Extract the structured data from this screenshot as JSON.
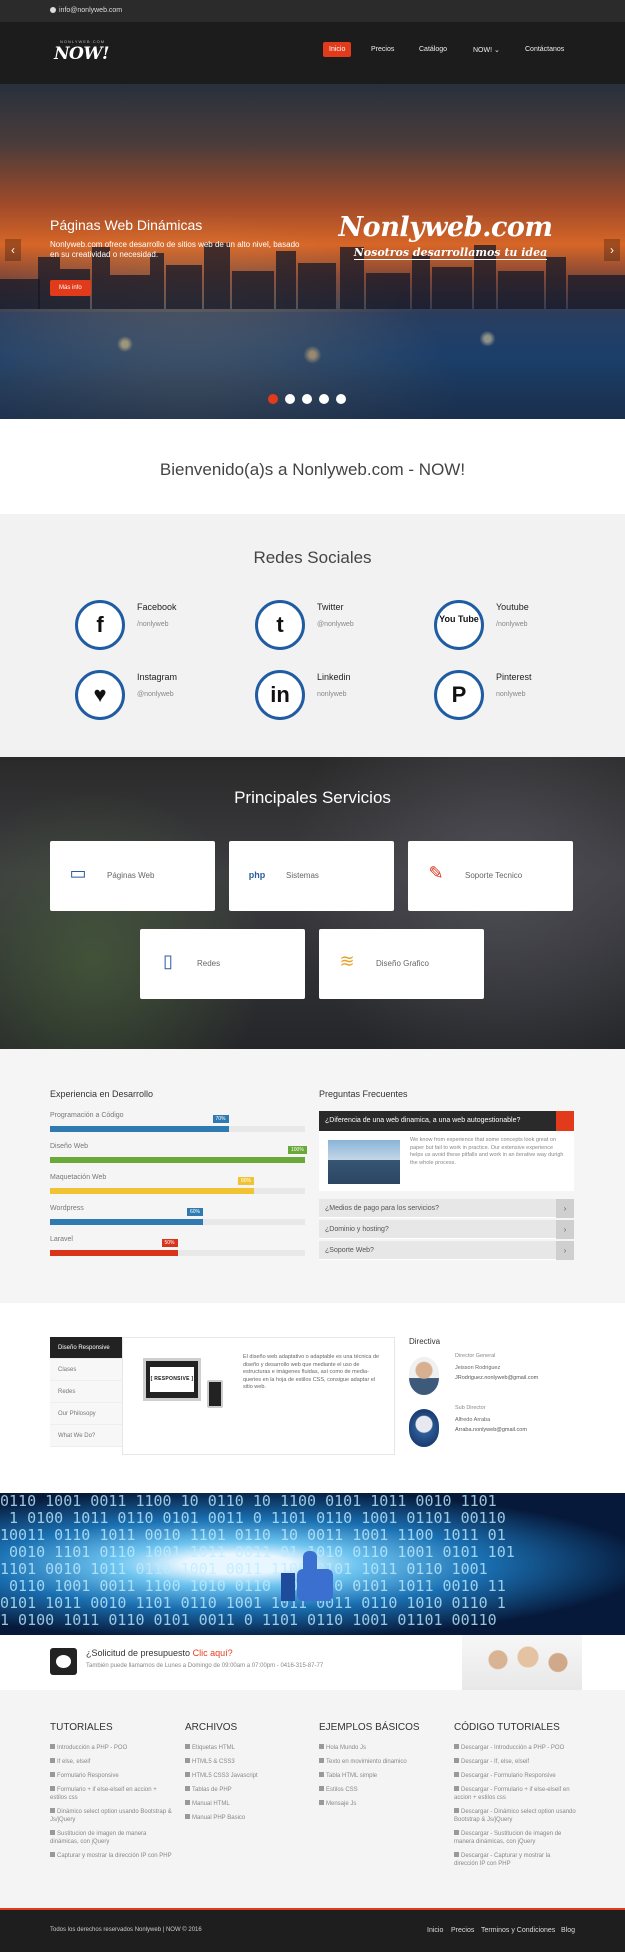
{
  "topbar": {
    "email": "info@nonlyweb.com"
  },
  "nav": {
    "logo_small": "NONLYWEB.COM",
    "logo": "NOW!",
    "items": [
      "Inicio",
      "Precios",
      "Catálogo",
      "NOW!",
      "Contáctanos"
    ],
    "dropdown_arrow": "chevron-down-icon"
  },
  "hero": {
    "title": "Páginas Web Dinámicas",
    "text": "Nonlyweb.com ofrece desarrollo de sitios web de un alto nivel, basado en su creatividad o necesidad.",
    "button": "Más info",
    "brand": "Nonlyweb.com",
    "tagline": "Nosotros desarrollamos tu idea",
    "slides": 5,
    "active_slide": 1
  },
  "welcome": {
    "title": "Bienvenido(a)s a Nonlyweb.com - NOW!"
  },
  "social": {
    "title": "Redes Sociales",
    "items": [
      {
        "name": "Facebook",
        "handle": "/nonlyweb",
        "glyph": "f"
      },
      {
        "name": "Twitter",
        "handle": "@nonlyweb",
        "glyph": "t"
      },
      {
        "name": "Youtube",
        "handle": "/nonlyweb",
        "glyph": "You Tube"
      },
      {
        "name": "Instagram",
        "handle": "@nonlyweb",
        "glyph": "♥"
      },
      {
        "name": "Linkedin",
        "handle": "nonlyweb",
        "glyph": "in"
      },
      {
        "name": "Pinterest",
        "handle": "nonlyweb",
        "glyph": "P"
      }
    ]
  },
  "services": {
    "title": "Principales Servicios",
    "items": [
      {
        "label": "Páginas Web",
        "icon": "laptop-icon"
      },
      {
        "label": "Sistemas",
        "icon": "php-icon"
      },
      {
        "label": "Soporte Tecnico",
        "icon": "support-icon"
      },
      {
        "label": "Redes",
        "icon": "tablet-icon"
      },
      {
        "label": "Diseño Grafico",
        "icon": "palette-icon"
      }
    ]
  },
  "experience": {
    "title": "Experiencia en Desarrollo",
    "skills": [
      {
        "name": "Programación a Código",
        "percent": 70,
        "label": "70%",
        "color": "#2f7ab0"
      },
      {
        "name": "Diseño Web",
        "percent": 100,
        "label": "100%",
        "color": "#6aa83a"
      },
      {
        "name": "Maquetación Web",
        "percent": 80,
        "label": "80%",
        "color": "#f1c232"
      },
      {
        "name": "Wordpress",
        "percent": 60,
        "label": "60%",
        "color": "#2f7ab0"
      },
      {
        "name": "Laravel",
        "percent": 50,
        "label": "50%",
        "color": "#d9331b"
      }
    ]
  },
  "faq": {
    "title": "Preguntas Frecuentes",
    "open_question": "¿Diferencia de una web dinamica, a una web autogestionable?",
    "answer": "We know from experience that some concepts look great on paper but fail to work in practice. Our extensive experience helps us avoid these pitfalls and work in an iterative way durigh the whole process.",
    "questions": [
      "¿Medios de pago para los servicios?",
      "¿Dominio y hosting?",
      "¿Soporte Web?"
    ]
  },
  "tabs": {
    "items": [
      "Diseño Responsive",
      "Clases",
      "Redes",
      "Our Philosopy",
      "What We Do?"
    ],
    "responsive_label": "[ RESPONSIVE ]",
    "content": "El diseño web adaptativo o adaptable es una técnica de diseño y desarrollo web que mediante el uso de estructuras e imágenes fluidas, así como de media-queries en la hoja de estilos CSS, consigue adaptar el sitio web."
  },
  "directiva": {
    "title": "Directiva",
    "people": [
      {
        "role": "Director General",
        "name": "Jeisson Rodriguez",
        "email": "JRodriguez.nonlyweb@gmail.com"
      },
      {
        "role": "Sub Director",
        "name": "Alfredo Arraba",
        "email": "Arraba.nonlyweb@gmail.com"
      }
    ]
  },
  "presupuesto": {
    "title": "¿Solicitud de presupuesto",
    "link": "Clic aquí?",
    "subtitle": "También puede llamarnos de Lunes a Domingo de 09:00am a 07:00pm - 0416-315-87-77"
  },
  "footer": {
    "columns": [
      {
        "title": "TUTORIALES",
        "links": [
          "Introducción a PHP - POO",
          "If else, elseif",
          "Formulario Responsive",
          "Formulario + if else-elseif en accion + estilos css",
          "Dinámico select option usando Bootstrap & Js/jQuery",
          "Sustitucion de imagen de manera dinámicas, con jQuery",
          "Capturar y mostrar la dirección IP con PHP"
        ]
      },
      {
        "title": "ARCHIVOS",
        "links": [
          "Etiquetas HTML",
          "HTML5 & CSS3",
          "HTML5 CSS3 Javascript",
          "Tablas de PHP",
          "Manual HTML",
          "Manual PHP Basico"
        ]
      },
      {
        "title": "EJEMPLOS BÁSICOS",
        "links": [
          "Hola Mundo Js",
          "Texto en movimiento dinamico",
          "Tabla HTML simple",
          "Estilos CSS",
          "Mensaje Js"
        ]
      },
      {
        "title": "CÓDIGO TUTORIALES",
        "links": [
          "Descargar - Introducción a PHP - POO",
          "Descargar - If, else, elseif",
          "Descargar - Formulario Responsive",
          "Descargar - Formulario + if else-elseif en accion + estilos css",
          "Descargar - Dinámico select option usando Bootstrap & Js/jQuery",
          "Descargar - Sustitucion de imagen de manera dinámicas, con jQuery",
          "Descargar - Capturar y mostrar la dirección IP con PHP"
        ]
      }
    ],
    "copyright": "Todos los derechos reservados Nonlyweb | NOW © 2016",
    "links": [
      "Inicio",
      "Precios",
      "Terminos y Condiciones",
      "Blog"
    ]
  }
}
